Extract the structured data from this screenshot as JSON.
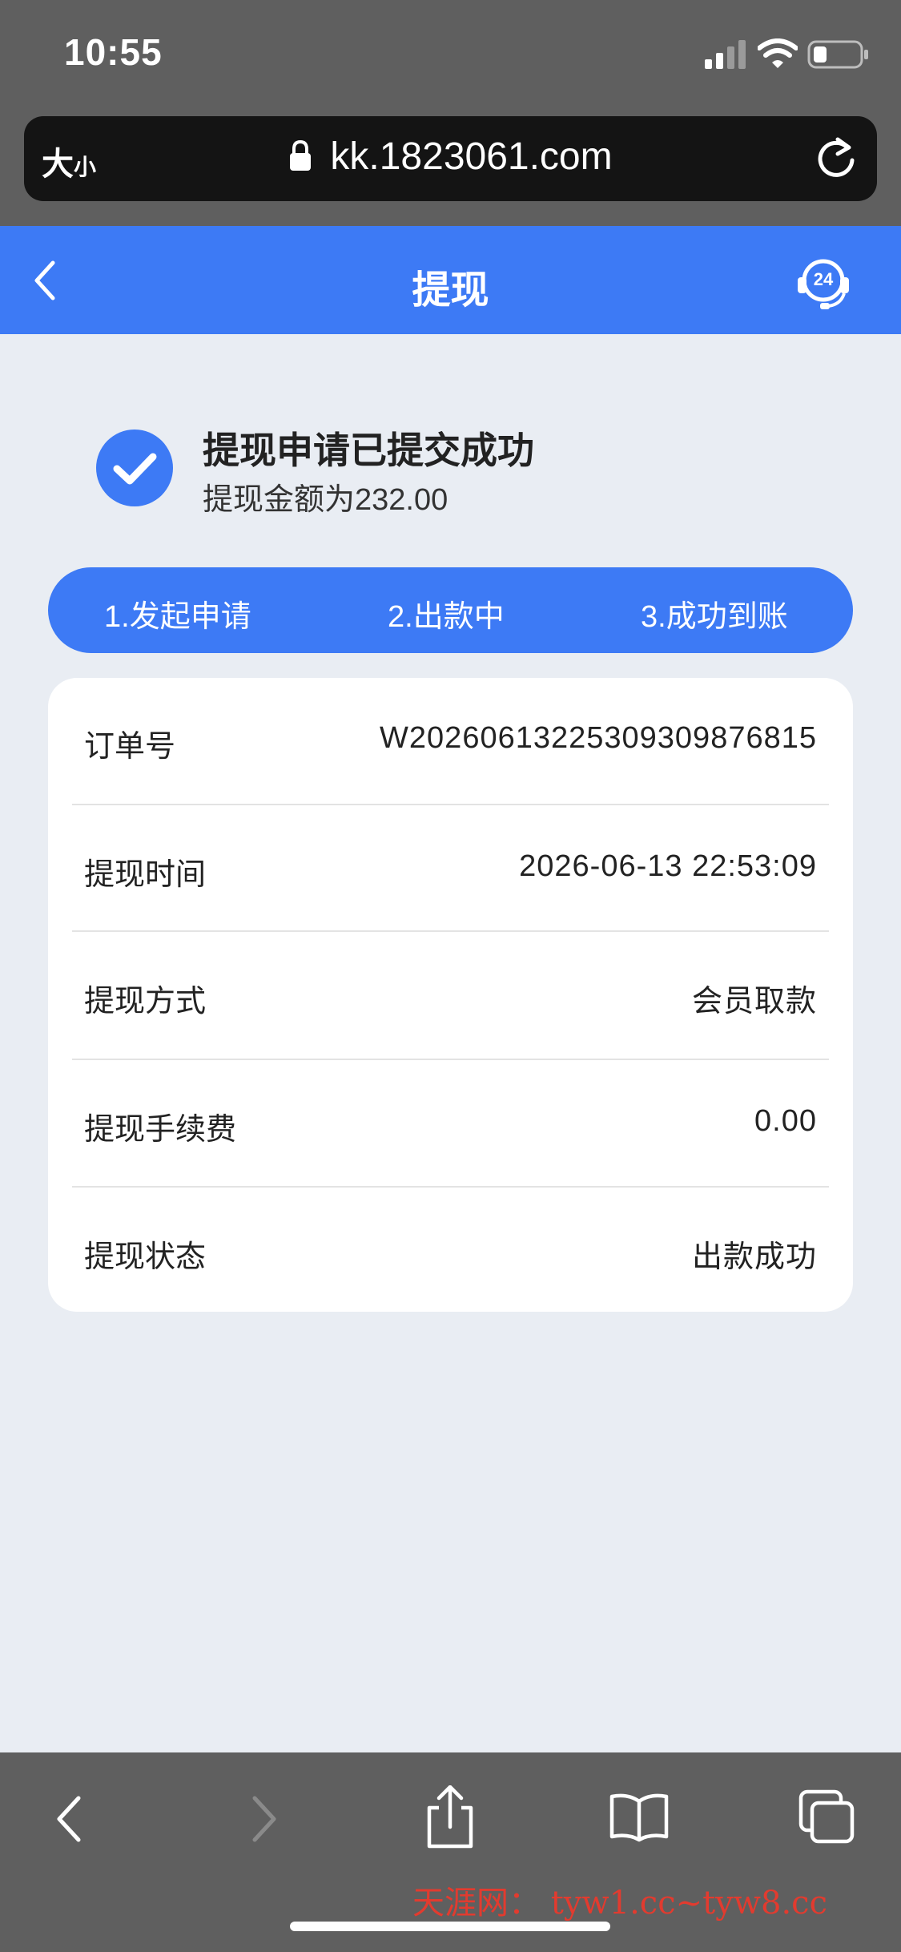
{
  "status_bar": {
    "time": "10:55"
  },
  "browser": {
    "size_label_big": "大",
    "size_label_small": "小",
    "url": "kk.1823061.com"
  },
  "header": {
    "title": "提现"
  },
  "success": {
    "title": "提现申请已提交成功",
    "amount_text": "提现金额为232.00"
  },
  "steps": [
    {
      "label": "1.发起申请"
    },
    {
      "label": "2.出款中"
    },
    {
      "label": "3.成功到账"
    }
  ],
  "details": [
    {
      "label": "订单号",
      "value": "W20260613225309309876815"
    },
    {
      "label": "提现时间",
      "value": "2026-06-13 22:53:09"
    },
    {
      "label": "提现方式",
      "value": "会员取款"
    },
    {
      "label": "提现手续费",
      "value": "0.00"
    },
    {
      "label": "提现状态",
      "value": "出款成功"
    }
  ],
  "support_badge": "24",
  "watermark": "天涯网： tyw1.cc~tyw8.cc",
  "colors": {
    "accent": "#3d7af5",
    "background": "#e9edf3",
    "chrome": "#5f5f5f"
  }
}
